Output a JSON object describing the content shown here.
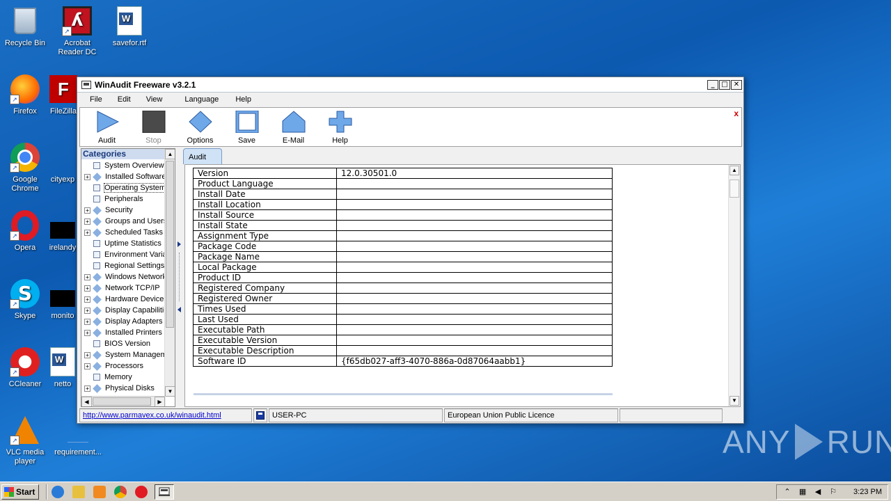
{
  "desktop": {
    "icons": [
      {
        "label": "Recycle Bin"
      },
      {
        "label": "Acrobat Reader DC"
      },
      {
        "label": "savefor.rtf"
      },
      {
        "label": "Firefox"
      },
      {
        "label": "FileZilla"
      },
      {
        "label": "Google Chrome"
      },
      {
        "label": "cityexp"
      },
      {
        "label": "Opera"
      },
      {
        "label": "irelandy"
      },
      {
        "label": "Skype"
      },
      {
        "label": "monito"
      },
      {
        "label": "CCleaner"
      },
      {
        "label": "netto"
      },
      {
        "label": "VLC media player"
      },
      {
        "label": "requirement..."
      }
    ]
  },
  "window": {
    "title": "WinAudit Freeware v3.2.1",
    "controls": {
      "minimize": "_",
      "maximize": "□",
      "close": "✕"
    }
  },
  "menu": [
    "File",
    "Edit",
    "View",
    "Language",
    "Help"
  ],
  "toolbar": {
    "buttons": [
      {
        "label": "Audit",
        "icon": "play-icon",
        "enabled": true
      },
      {
        "label": "Stop",
        "icon": "stop-icon",
        "enabled": false
      },
      {
        "label": "Options",
        "icon": "diamond-icon",
        "enabled": true
      },
      {
        "label": "Save",
        "icon": "save-icon",
        "enabled": true
      },
      {
        "label": "E-Mail",
        "icon": "house-icon",
        "enabled": true
      },
      {
        "label": "Help",
        "icon": "plus-icon",
        "enabled": true
      }
    ],
    "close_glyph": "x"
  },
  "categories": {
    "header": "Categories",
    "items": [
      {
        "label": "System Overview",
        "expandable": false,
        "icon": "page"
      },
      {
        "label": "Installed Software",
        "expandable": true,
        "icon": "diamond"
      },
      {
        "label": "Operating System",
        "expandable": false,
        "icon": "page",
        "selected": true
      },
      {
        "label": "Peripherals",
        "expandable": false,
        "icon": "page"
      },
      {
        "label": "Security",
        "expandable": true,
        "icon": "diamond"
      },
      {
        "label": "Groups and Users",
        "expandable": true,
        "icon": "diamond"
      },
      {
        "label": "Scheduled Tasks",
        "expandable": true,
        "icon": "diamond"
      },
      {
        "label": "Uptime Statistics",
        "expandable": false,
        "icon": "page"
      },
      {
        "label": "Environment Variables",
        "expandable": false,
        "icon": "page"
      },
      {
        "label": "Regional Settings",
        "expandable": false,
        "icon": "page"
      },
      {
        "label": "Windows Network",
        "expandable": true,
        "icon": "diamond"
      },
      {
        "label": "Network TCP/IP",
        "expandable": true,
        "icon": "diamond"
      },
      {
        "label": "Hardware Devices",
        "expandable": true,
        "icon": "diamond"
      },
      {
        "label": "Display Capabilities",
        "expandable": true,
        "icon": "diamond"
      },
      {
        "label": "Display Adapters",
        "expandable": true,
        "icon": "diamond"
      },
      {
        "label": "Installed Printers",
        "expandable": true,
        "icon": "diamond"
      },
      {
        "label": "BIOS Version",
        "expandable": false,
        "icon": "page"
      },
      {
        "label": "System Management",
        "expandable": true,
        "icon": "diamond"
      },
      {
        "label": "Processors",
        "expandable": true,
        "icon": "diamond"
      },
      {
        "label": "Memory",
        "expandable": false,
        "icon": "page"
      },
      {
        "label": "Physical Disks",
        "expandable": true,
        "icon": "diamond"
      }
    ]
  },
  "tab": {
    "label": "Audit"
  },
  "properties": [
    {
      "key": "Version",
      "value": "12.0.30501.0"
    },
    {
      "key": "Product Language",
      "value": ""
    },
    {
      "key": "Install Date",
      "value": ""
    },
    {
      "key": "Install Location",
      "value": ""
    },
    {
      "key": "Install Source",
      "value": ""
    },
    {
      "key": "Install State",
      "value": ""
    },
    {
      "key": "Assignment Type",
      "value": ""
    },
    {
      "key": "Package Code",
      "value": ""
    },
    {
      "key": "Package Name",
      "value": ""
    },
    {
      "key": "Local Package",
      "value": ""
    },
    {
      "key": "Product ID",
      "value": ""
    },
    {
      "key": "Registered Company",
      "value": ""
    },
    {
      "key": "Registered Owner",
      "value": ""
    },
    {
      "key": "Times Used",
      "value": ""
    },
    {
      "key": "Last Used",
      "value": ""
    },
    {
      "key": "Executable Path",
      "value": ""
    },
    {
      "key": "Executable Version",
      "value": ""
    },
    {
      "key": "Executable Description",
      "value": ""
    },
    {
      "key": "Software ID",
      "value": "{f65db027-aff3-4070-886a-0d87064aabb1}"
    }
  ],
  "statusbar": {
    "url": "http://www.parmavex.co.uk/winaudit.html",
    "computer": "USER-PC",
    "licence": "European Union Public Licence",
    "extra": ""
  },
  "taskbar": {
    "start_label": "Start",
    "clock": "3:23 PM"
  },
  "watermark": {
    "left": "ANY",
    "right": "RUN"
  },
  "colors": {
    "desktop": "#1565c0",
    "accent_blue": "#6fa8e8",
    "link": "#0000cc"
  }
}
